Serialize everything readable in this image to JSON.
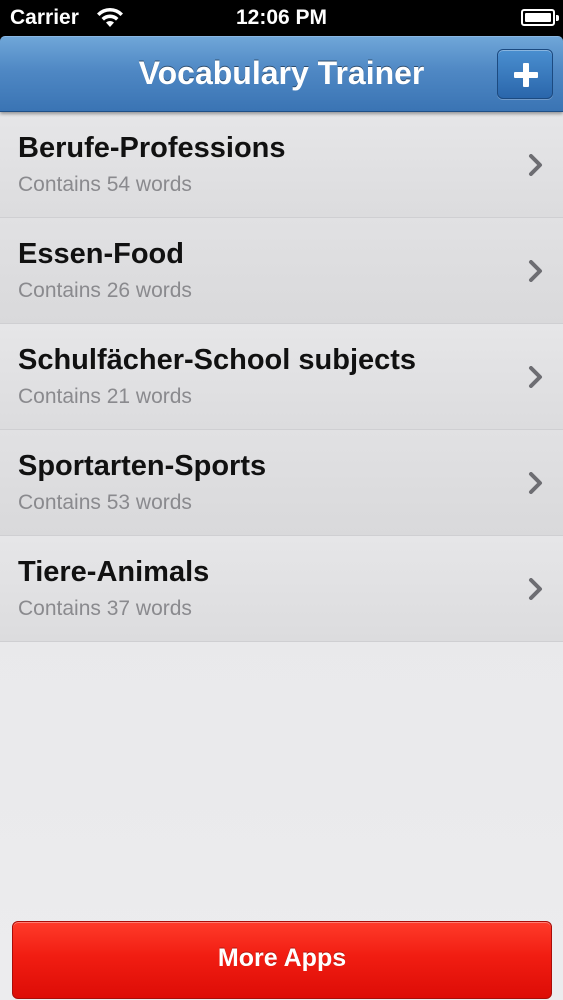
{
  "status_bar": {
    "carrier": "Carrier",
    "time": "12:06 PM",
    "wifi_icon": "wifi-icon",
    "battery_icon": "battery-icon"
  },
  "nav": {
    "title": "Vocabulary Trainer",
    "add_icon": "plus-icon",
    "accent_color": "#4a84c2"
  },
  "lists": [
    {
      "name": "Berufe-Professions",
      "count": "Contains 54 words"
    },
    {
      "name": "Essen-Food",
      "count": "Contains 26 words"
    },
    {
      "name": "Schulfächer-School subjects",
      "count": "Contains 21 words"
    },
    {
      "name": "Sportarten-Sports",
      "count": "Contains 53 words"
    },
    {
      "name": "Tiere-Animals",
      "count": "Contains 37 words"
    }
  ],
  "footer": {
    "more_apps_label": "More Apps",
    "button_color": "#f11d12"
  }
}
